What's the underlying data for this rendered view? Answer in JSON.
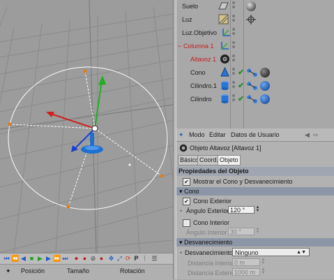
{
  "objects": [
    {
      "name": "Suelo",
      "icon": "floor-icon",
      "selected": false
    },
    {
      "name": "Luz",
      "icon": "light-icon",
      "selected": false
    },
    {
      "name": "Luz.Objetivo",
      "icon": "null-target-icon",
      "selected": false
    },
    {
      "name": "Columna 1",
      "icon": "null-group-icon",
      "selected": true
    },
    {
      "name": "Altavoz 1",
      "icon": "speaker-icon",
      "selected": true
    },
    {
      "name": "Cono",
      "icon": "cone-icon",
      "selected": false
    },
    {
      "name": "Cilindro.1",
      "icon": "cylinder-icon",
      "selected": false
    },
    {
      "name": "Cilindro",
      "icon": "cylinder-icon",
      "selected": false
    }
  ],
  "attr_menu": {
    "mode": "Modo",
    "edit": "Editar",
    "user_data": "Datos de Usuario"
  },
  "object_title": "Objeto Altavoz [Altavoz 1]",
  "tabs": [
    "Básico",
    "Coord.",
    "Objeto"
  ],
  "properties_header": "Propiedades del Objeto",
  "show_cone": "Mostrar el Cono y Desvanecimiento",
  "cone_section": "Cono",
  "outer_cone_label": "Cono Exterior",
  "outer_angle_label": "Ángulo Exterior",
  "outer_angle_value": "120 °",
  "inner_cone_label": "Cono Interior",
  "inner_angle_label": "Ángulo Interior",
  "inner_angle_value": "30 °",
  "falloff_section": "Desvanecimiento",
  "falloff_label": "Desvanecimiento",
  "falloff_value": "Ninguno",
  "inner_distance_label": "Distancia Interior",
  "inner_distance_value": "0 m",
  "outer_distance_label": "Distancia Exterior",
  "outer_distance_value": "1000 m",
  "coord_headers": {
    "position": "Posición",
    "size": "Tamaño",
    "rotation": "Rotación"
  },
  "colors": {
    "selected_text": "#c41d1d",
    "section_blue": "#8d96a6",
    "object_blue": "#1e6fd0"
  }
}
